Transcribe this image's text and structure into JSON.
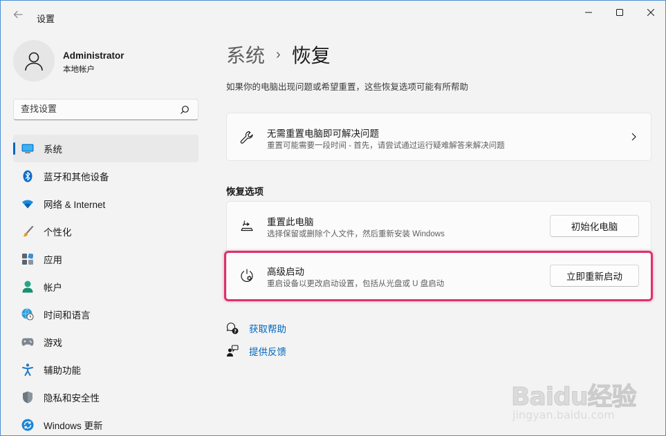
{
  "window": {
    "title": "设置",
    "back_icon": "arrow-left-icon"
  },
  "profile": {
    "name": "Administrator",
    "account_type": "本地帐户"
  },
  "search": {
    "placeholder": "查找设置"
  },
  "sidebar": {
    "items": [
      {
        "label": "系统",
        "icon": "monitor-icon",
        "selected": true
      },
      {
        "label": "蓝牙和其他设备",
        "icon": "bluetooth-icon"
      },
      {
        "label": "网络 & Internet",
        "icon": "wifi-icon"
      },
      {
        "label": "个性化",
        "icon": "brush-icon"
      },
      {
        "label": "应用",
        "icon": "apps-icon"
      },
      {
        "label": "帐户",
        "icon": "person-icon"
      },
      {
        "label": "时间和语言",
        "icon": "globe-clock-icon"
      },
      {
        "label": "游戏",
        "icon": "gamepad-icon"
      },
      {
        "label": "辅助功能",
        "icon": "accessibility-icon"
      },
      {
        "label": "隐私和安全性",
        "icon": "shield-icon"
      },
      {
        "label": "Windows 更新",
        "icon": "update-icon"
      }
    ]
  },
  "main": {
    "breadcrumb_parent": "系统",
    "breadcrumb_sep": "›",
    "breadcrumb_current": "恢复",
    "description": "如果你的电脑出现问题或希望重置，这些恢复选项可能有所帮助",
    "troubleshoot": {
      "title": "无需重置电脑即可解决问题",
      "subtitle": "重置可能需要一段时间 - 首先，请尝试通过运行疑难解答来解决问题"
    },
    "section_title": "恢复选项",
    "reset": {
      "title": "重置此电脑",
      "subtitle": "选择保留或删除个人文件，然后重新安装 Windows",
      "button": "初始化电脑"
    },
    "advanced": {
      "title": "高级启动",
      "subtitle": "重启设备以更改启动设置，包括从光盘或 U 盘启动",
      "button": "立即重新启动"
    },
    "links": {
      "help": "获取帮助",
      "feedback": "提供反馈"
    }
  },
  "watermark": {
    "brand": "Baidu经验",
    "url": "jingyan.baidu.com"
  },
  "colors": {
    "accent": "#0067c0",
    "highlight": "#e0306a"
  }
}
